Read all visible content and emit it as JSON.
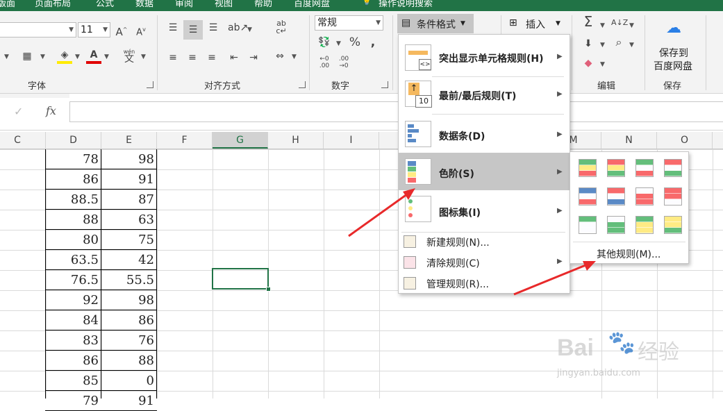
{
  "tabs": [
    "版面",
    "页面布局",
    "公式",
    "数据",
    "审阅",
    "视图",
    "帮助",
    "百度网盘",
    "操作说明搜索"
  ],
  "ribbon": {
    "font_size": "11",
    "number_format": "常规",
    "percent_symbol": "%",
    "comma_symbol": ",",
    "inc_decimal": ".00",
    "dec_decimal": ".00",
    "wen_label": "wén",
    "wen_char": "文",
    "cond_format_label": "条件格式",
    "insert_label": "插入",
    "save_label_line1": "保存到",
    "save_label_line2": "百度网盘",
    "groups": {
      "font": "字体",
      "alignment": "对齐方式",
      "number": "数字",
      "editing": "编辑",
      "save": "保存"
    }
  },
  "formula_bar": {
    "cancel_icon": "✓",
    "fx": "fx",
    "value": ""
  },
  "columns": [
    "C",
    "D",
    "E",
    "F",
    "G",
    "H",
    "I",
    "M",
    "N",
    "O"
  ],
  "selected_column": "G",
  "table": {
    "D": [
      "78",
      "86",
      "88.5",
      "88",
      "80",
      "63.5",
      "76.5",
      "92",
      "84",
      "83",
      "86",
      "85",
      "79"
    ],
    "E": [
      "98",
      "91",
      "87",
      "63",
      "75",
      "42",
      "55.5",
      "98",
      "86",
      "76",
      "88",
      "0",
      "91"
    ]
  },
  "menu": {
    "items": [
      {
        "label": "突出显示单元格规则(H)",
        "icon": "highlight-rules-icon"
      },
      {
        "label": "最前/最后规则(T)",
        "icon": "top-bottom-rules-icon"
      },
      {
        "label": "数据条(D)",
        "icon": "data-bars-icon"
      },
      {
        "label": "色阶(S)",
        "icon": "color-scales-icon"
      },
      {
        "label": "图标集(I)",
        "icon": "icon-sets-icon"
      }
    ],
    "small_items": [
      {
        "label": "新建规则(N)...",
        "icon": "new-rule-icon"
      },
      {
        "label": "清除规则(C)",
        "icon": "clear-rules-icon"
      },
      {
        "label": "管理规则(R)...",
        "icon": "manage-rules-icon"
      }
    ],
    "top10_text": "10"
  },
  "submenu": {
    "more_rules": "其他规则(M)...",
    "scales": [
      [
        "#63be7b",
        "#ffeb84",
        "#f8696b"
      ],
      [
        "#f8696b",
        "#ffeb84",
        "#63be7b"
      ],
      [
        "#63be7b",
        "#fcfcff",
        "#f8696b"
      ],
      [
        "#f8696b",
        "#fcfcff",
        "#63be7b"
      ],
      [
        "#5a8ac6",
        "#fcfcff",
        "#f8696b"
      ],
      [
        "#f8696b",
        "#fcfcff",
        "#5a8ac6"
      ],
      [
        "#fcfcff",
        "#f8696b",
        "#f8696b"
      ],
      [
        "#f8696b",
        "#f8696b",
        "#fcfcff"
      ],
      [
        "#63be7b",
        "#fcfcff",
        "#fcfcff"
      ],
      [
        "#fcfcff",
        "#63be7b",
        "#63be7b"
      ],
      [
        "#63be7b",
        "#ffeb84",
        "#ffeb84"
      ],
      [
        "#ffeb84",
        "#ffeb84",
        "#63be7b"
      ]
    ]
  },
  "watermark": {
    "logo": "Bai",
    "logo_suffix": "经验",
    "url": "jingyan.baidu.com"
  },
  "colors": {
    "excel_green": "#217346",
    "arrow_red": "#e8292a",
    "highlight_gray": "#c6c6c6"
  }
}
